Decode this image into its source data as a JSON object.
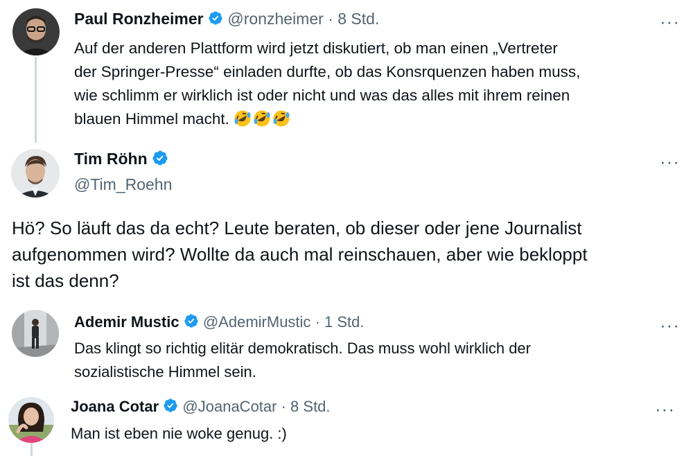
{
  "tweets": [
    {
      "name": "Paul Ronzheimer",
      "handle": "@ronzheimer",
      "time": "· 8 Std.",
      "text_lines": [
        "Auf der anderen Plattform wird jetzt  diskutiert, ob man einen „Vertreter",
        "der Springer-Presse“ einladen durfte, ob das Konsrquenzen haben muss,",
        "wie schlimm er wirklich ist oder nicht und was das alles mit ihrem reinen",
        "blauen Himmel macht."
      ],
      "emoji_count": 3
    },
    {
      "name": "Tim Röhn",
      "handle": "@Tim_Roehn",
      "text_lines": [
        "Hö? So läuft das da echt? Leute beraten, ob dieser oder jene Journalist",
        "aufgenommen wird? Wollte da auch mal reinschauen, aber wie bekloppt",
        "ist das denn?"
      ]
    },
    {
      "name": "Ademir Mustic",
      "handle": "@AdemirMustic",
      "time": "· 1 Std.",
      "text_lines": [
        "Das klingt so richtig elitär demokratisch. Das muss wohl wirklich der",
        "sozialistische Himmel sein."
      ]
    },
    {
      "name": "Joana Cotar",
      "handle": "@JoanaCotar",
      "time": "· 8 Std.",
      "text_lines": [
        "Man ist eben nie woke genug. :)"
      ]
    }
  ],
  "more_label": "···",
  "colors": {
    "verified_blue": "#1d9bf0",
    "text": "#0f1419",
    "muted": "#536471",
    "thread_line": "#cfd9de"
  },
  "icons": {
    "verified": "verified-badge-icon",
    "more": "more-horizontal-icon",
    "emoji": "rolling-on-floor-laughing-emoji"
  }
}
